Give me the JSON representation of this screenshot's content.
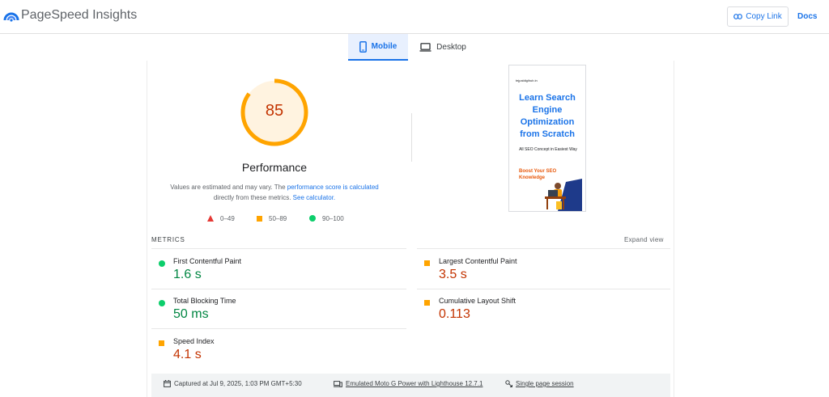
{
  "header": {
    "app_title": "PageSpeed Insights",
    "copy_link_label": "Copy Link",
    "docs_label": "Docs"
  },
  "tabs": [
    {
      "label": "Mobile",
      "active": true
    },
    {
      "label": "Desktop",
      "active": false
    }
  ],
  "performance": {
    "score": "85",
    "score_fraction": 0.85,
    "title": "Performance",
    "note_prefix": "Values are estimated and may vary. The ",
    "note_link1": "performance score is calculated",
    "note_middle": " directly from these metrics. ",
    "note_link2": "See calculator."
  },
  "legend": {
    "fail": "0–49",
    "average": "50–89",
    "pass": "90–100"
  },
  "screenshot": {
    "site": "tejpaldigihub.in",
    "headline_lines": [
      "Learn Search",
      "Engine",
      "Optimization",
      "from Scratch"
    ],
    "subline": "All SEO Concept in Easiest Way",
    "boost": "Boost Your SEO Knowledge"
  },
  "metrics": {
    "label": "METRICS",
    "expand_label": "Expand view",
    "items": [
      {
        "name": "First Contentful Paint",
        "value": "1.6 s",
        "status": "pass"
      },
      {
        "name": "Largest Contentful Paint",
        "value": "3.5 s",
        "status": "average"
      },
      {
        "name": "Total Blocking Time",
        "value": "50 ms",
        "status": "pass"
      },
      {
        "name": "Cumulative Layout Shift",
        "value": "0.113",
        "status": "average"
      },
      {
        "name": "Speed Index",
        "value": "4.1 s",
        "status": "average"
      }
    ]
  },
  "footer": {
    "captured": "Captured at Jul 9, 2025, 1:03 PM GMT+5:30",
    "device": "Emulated Moto G Power with Lighthouse 12.7.1",
    "session": "Single page session"
  },
  "colors": {
    "accent": "#1a73e8",
    "average": "#ffa400",
    "pass": "#0cce6b",
    "fail": "#e53935"
  },
  "icons": {
    "logo": "pagespeed-logo-icon",
    "copy": "link-icon",
    "mobile": "mobile-phone-icon",
    "desktop": "laptop-icon",
    "calendar": "calendar-icon",
    "device": "device-icon",
    "session": "session-icon"
  }
}
